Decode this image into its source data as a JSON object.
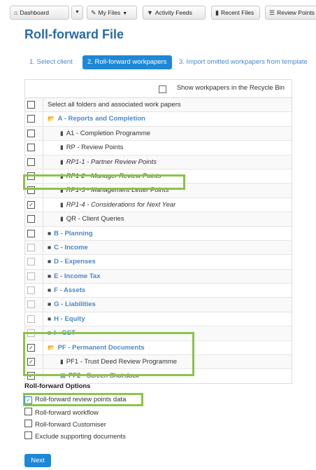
{
  "toolbar": {
    "dashboard": "Dashboard",
    "my_files": "My Files",
    "activity_feeds": "Activity Feeds",
    "recent_files": "Recent Files",
    "review_points": "Review Points"
  },
  "page_title": "Roll-forward File",
  "steps": [
    "1. Select client",
    "2. Roll-forward workpapers",
    "3. Import omitted workpapers from template"
  ],
  "tree": {
    "show_recycle_label": "Show workpapers in the Recycle Bin",
    "rows": [
      {
        "label": "Select all folders and associated work papers",
        "checked": false
      },
      {
        "label": "A - Reports and Completion",
        "checked": false
      },
      {
        "label": "A1 - Completion Programme",
        "checked": false
      },
      {
        "label": "RP - Review Points",
        "checked": false
      },
      {
        "label": "RP1-1 - Partner Review Points",
        "checked": false
      },
      {
        "label": "RP1-2 - Manager Review Points",
        "checked": false
      },
      {
        "label": "RP1-3 - Management Letter Points",
        "checked": false
      },
      {
        "label": "RP1-4 - Considerations for Next Year",
        "checked": true
      },
      {
        "label": "QR - Client Queries",
        "checked": false
      },
      {
        "label": "B - Planning",
        "checked": false
      },
      {
        "label": "C - Income",
        "checked": false
      },
      {
        "label": "D - Expenses",
        "checked": false
      },
      {
        "label": "E - Income Tax",
        "checked": false
      },
      {
        "label": "F - Assets",
        "checked": false
      },
      {
        "label": "G - Liabilities",
        "checked": false
      },
      {
        "label": "H - Equity",
        "checked": false
      },
      {
        "label": "I - GST",
        "checked": false
      },
      {
        "label": "PF - Permanent Documents",
        "checked": true
      },
      {
        "label": "PF1 - Trust Deed Review Programme",
        "checked": true
      },
      {
        "label": "PF2 - Screen Shot.docx",
        "checked": true
      }
    ]
  },
  "options": {
    "title": "Roll-forward Options",
    "items": [
      {
        "label": "Roll-forward review points data",
        "checked": true
      },
      {
        "label": "Roll-forward workflow",
        "checked": false
      },
      {
        "label": "Roll-forward Customiser",
        "checked": false
      },
      {
        "label": "Exclude supporting documents",
        "checked": false
      }
    ]
  },
  "next_label": "Next",
  "check_mark": "✓"
}
